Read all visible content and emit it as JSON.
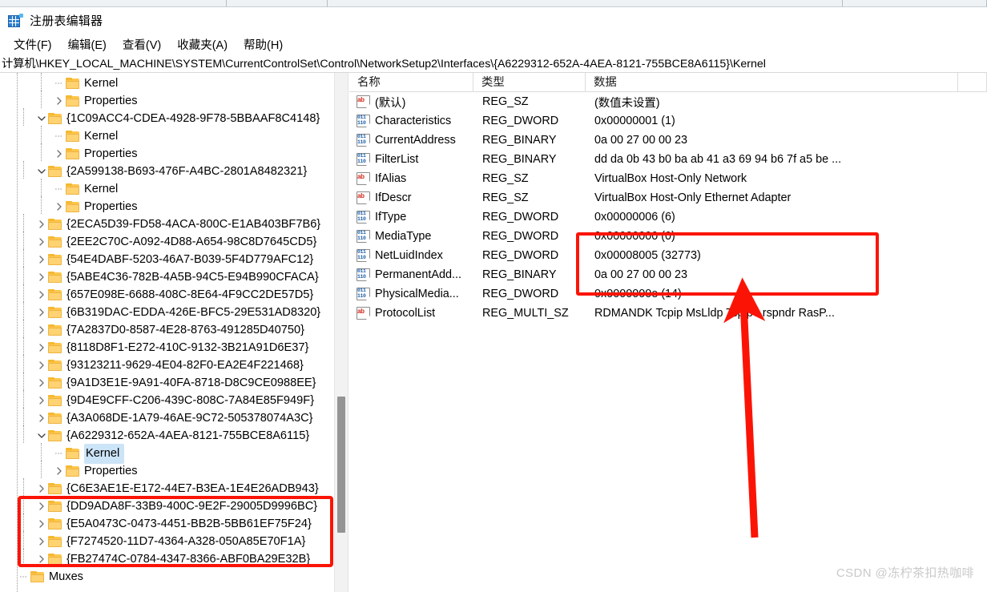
{
  "window": {
    "title": "注册表编辑器",
    "icon": "registry-editor-icon"
  },
  "menubar": {
    "items": [
      {
        "label": "文件(F)"
      },
      {
        "label": "编辑(E)"
      },
      {
        "label": "查看(V)"
      },
      {
        "label": "收藏夹(A)"
      },
      {
        "label": "帮助(H)"
      }
    ]
  },
  "address": {
    "path": "计算机\\HKEY_LOCAL_MACHINE\\SYSTEM\\CurrentControlSet\\Control\\NetworkSetup2\\Interfaces\\{A6229312-652A-4AEA-8121-755BCE8A6115}\\Kernel"
  },
  "tree": {
    "nodes": [
      {
        "label": "Kernel",
        "depth": 2,
        "twisty": "none",
        "selected": false
      },
      {
        "label": "Properties",
        "depth": 2,
        "twisty": "collapsed",
        "selected": false
      },
      {
        "label": "{1C09ACC4-CDEA-4928-9F78-5BBAAF8C4148}",
        "depth": 1,
        "twisty": "expanded",
        "selected": false
      },
      {
        "label": "Kernel",
        "depth": 2,
        "twisty": "none",
        "selected": false
      },
      {
        "label": "Properties",
        "depth": 2,
        "twisty": "collapsed",
        "selected": false
      },
      {
        "label": "{2A599138-B693-476F-A4BC-2801A8482321}",
        "depth": 1,
        "twisty": "expanded",
        "selected": false
      },
      {
        "label": "Kernel",
        "depth": 2,
        "twisty": "none",
        "selected": false
      },
      {
        "label": "Properties",
        "depth": 2,
        "twisty": "collapsed",
        "selected": false
      },
      {
        "label": "{2ECA5D39-FD58-4ACA-800C-E1AB403BF7B6}",
        "depth": 1,
        "twisty": "collapsed",
        "selected": false
      },
      {
        "label": "{2EE2C70C-A092-4D88-A654-98C8D7645CD5}",
        "depth": 1,
        "twisty": "collapsed",
        "selected": false
      },
      {
        "label": "{54E4DABF-5203-46A7-B039-5F4D779AFC12}",
        "depth": 1,
        "twisty": "collapsed",
        "selected": false
      },
      {
        "label": "{5ABE4C36-782B-4A5B-94C5-E94B990CFACA}",
        "depth": 1,
        "twisty": "collapsed",
        "selected": false
      },
      {
        "label": "{657E098E-6688-408C-8E64-4F9CC2DE57D5}",
        "depth": 1,
        "twisty": "collapsed",
        "selected": false
      },
      {
        "label": "{6B319DAC-EDDA-426E-BFC5-29E531AD8320}",
        "depth": 1,
        "twisty": "collapsed",
        "selected": false
      },
      {
        "label": "{7A2837D0-8587-4E28-8763-491285D40750}",
        "depth": 1,
        "twisty": "collapsed",
        "selected": false
      },
      {
        "label": "{8118D8F1-E272-410C-9132-3B21A91D6E37}",
        "depth": 1,
        "twisty": "collapsed",
        "selected": false
      },
      {
        "label": "{93123211-9629-4E04-82F0-EA2E4F221468}",
        "depth": 1,
        "twisty": "collapsed",
        "selected": false
      },
      {
        "label": "{9A1D3E1E-9A91-40FA-8718-D8C9CE0988EE}",
        "depth": 1,
        "twisty": "collapsed",
        "selected": false
      },
      {
        "label": "{9D4E9CFF-C206-439C-808C-7A84E85F949F}",
        "depth": 1,
        "twisty": "collapsed",
        "selected": false
      },
      {
        "label": "{A3A068DE-1A79-46AE-9C72-505378074A3C}",
        "depth": 1,
        "twisty": "collapsed",
        "selected": false
      },
      {
        "label": "{A6229312-652A-4AEA-8121-755BCE8A6115}",
        "depth": 1,
        "twisty": "expanded",
        "selected": false
      },
      {
        "label": "Kernel",
        "depth": 2,
        "twisty": "none",
        "selected": true
      },
      {
        "label": "Properties",
        "depth": 2,
        "twisty": "collapsed",
        "selected": false
      },
      {
        "label": "{C6E3AE1E-E172-44E7-B3EA-1E4E26ADB943}",
        "depth": 1,
        "twisty": "collapsed",
        "selected": false
      },
      {
        "label": "{DD9ADA8F-33B9-400C-9E2F-29005D9996BC}",
        "depth": 1,
        "twisty": "collapsed",
        "selected": false
      },
      {
        "label": "{E5A0473C-0473-4451-BB2B-5BB61EF75F24}",
        "depth": 1,
        "twisty": "collapsed",
        "selected": false
      },
      {
        "label": "{F7274520-11D7-4364-A328-050A85E70F1A}",
        "depth": 1,
        "twisty": "collapsed",
        "selected": false
      },
      {
        "label": "{FB27474C-0784-4347-8366-ABF0BA29E32B}",
        "depth": 1,
        "twisty": "collapsed",
        "selected": false
      },
      {
        "label": "Muxes",
        "depth": 0,
        "twisty": "none",
        "selected": false
      }
    ]
  },
  "list": {
    "columns": [
      {
        "label": "名称"
      },
      {
        "label": "类型"
      },
      {
        "label": "数据"
      }
    ],
    "rows": [
      {
        "icon": "string-value-icon",
        "kind": "sz",
        "name": "(默认)",
        "type": "REG_SZ",
        "data": "(数值未设置)"
      },
      {
        "icon": "dword-value-icon",
        "kind": "dw",
        "name": "Characteristics",
        "type": "REG_DWORD",
        "data": "0x00000001 (1)"
      },
      {
        "icon": "dword-value-icon",
        "kind": "dw",
        "name": "CurrentAddress",
        "type": "REG_BINARY",
        "data": "0a 00 27 00 00 23"
      },
      {
        "icon": "dword-value-icon",
        "kind": "dw",
        "name": "FilterList",
        "type": "REG_BINARY",
        "data": "dd da 0b 43 b0 ba ab 41 a3 69 94 b6 7f a5 be ..."
      },
      {
        "icon": "string-value-icon",
        "kind": "sz",
        "name": "IfAlias",
        "type": "REG_SZ",
        "data": "VirtualBox Host-Only Network"
      },
      {
        "icon": "string-value-icon",
        "kind": "sz",
        "name": "IfDescr",
        "type": "REG_SZ",
        "data": "VirtualBox Host-Only Ethernet Adapter"
      },
      {
        "icon": "dword-value-icon",
        "kind": "dw",
        "name": "IfType",
        "type": "REG_DWORD",
        "data": "0x00000006 (6)"
      },
      {
        "icon": "dword-value-icon",
        "kind": "dw",
        "name": "MediaType",
        "type": "REG_DWORD",
        "data": "0x00000000 (0)"
      },
      {
        "icon": "dword-value-icon",
        "kind": "dw",
        "name": "NetLuidIndex",
        "type": "REG_DWORD",
        "data": "0x00008005 (32773)"
      },
      {
        "icon": "dword-value-icon",
        "kind": "dw",
        "name": "PermanentAdd...",
        "type": "REG_BINARY",
        "data": "0a 00 27 00 00 23"
      },
      {
        "icon": "dword-value-icon",
        "kind": "dw",
        "name": "PhysicalMedia...",
        "type": "REG_DWORD",
        "data": "0x0000000e (14)"
      },
      {
        "icon": "string-value-icon",
        "kind": "sz",
        "name": "ProtocolList",
        "type": "REG_MULTI_SZ",
        "data": "RDMANDK Tcpip MsLldp Tcpip6 rspndr RasP..."
      }
    ]
  },
  "annotations": {
    "color": "#fb1405",
    "tree_highlight_target": "{A6229312-652A-4AEA-8121-755BCE8A6115} Kernel",
    "data_highlight_target": "IfAlias / IfDescr data values",
    "arrow": "up-arrow-pointing-to-data-highlight"
  },
  "watermark": {
    "text": "CSDN @冻柠茶扣热咖啡"
  }
}
